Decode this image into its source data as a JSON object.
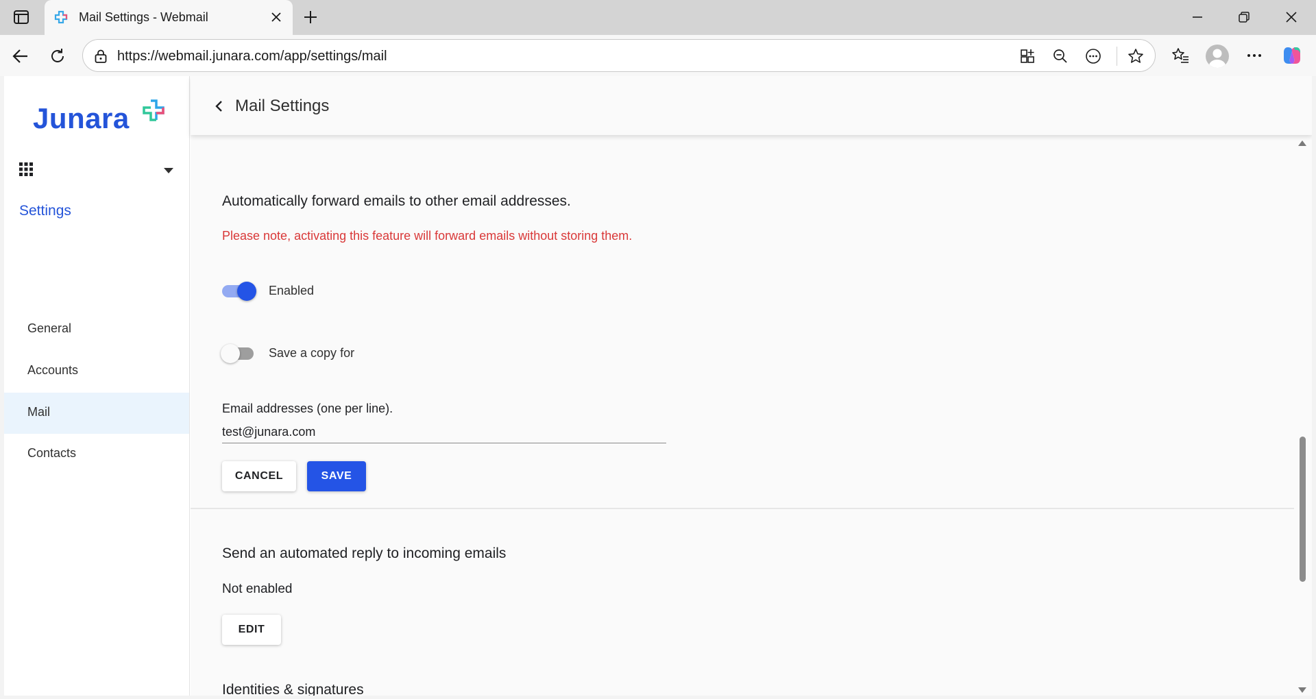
{
  "browser": {
    "tab_title": "Mail Settings - Webmail",
    "url": "https://webmail.junara.com/app/settings/mail"
  },
  "sidebar": {
    "logo_text": "Junara",
    "heading": "Settings",
    "items": [
      {
        "label": "General"
      },
      {
        "label": "Accounts"
      },
      {
        "label": "Mail",
        "active": true
      },
      {
        "label": "Contacts"
      }
    ]
  },
  "header": {
    "title": "Mail Settings"
  },
  "forwarding": {
    "title": "Automatically forward emails to other email addresses.",
    "warning": "Please note, activating this feature will forward emails without storing them.",
    "enabled_label": "Enabled",
    "enabled": true,
    "save_copy_label": "Save a copy for",
    "save_copy": false,
    "addresses_label": "Email addresses (one per line).",
    "addresses_value": "test@junara.com",
    "cancel_label": "CANCEL",
    "save_label": "SAVE"
  },
  "auto_reply": {
    "title": "Send an automated reply to incoming emails",
    "status": "Not enabled",
    "edit_label": "EDIT"
  },
  "identities": {
    "title": "Identities & signatures"
  },
  "colors": {
    "accent": "#2454e6",
    "brand": "#2454d9",
    "warning": "#d93838",
    "active_nav_bg": "#eaf4fd"
  }
}
